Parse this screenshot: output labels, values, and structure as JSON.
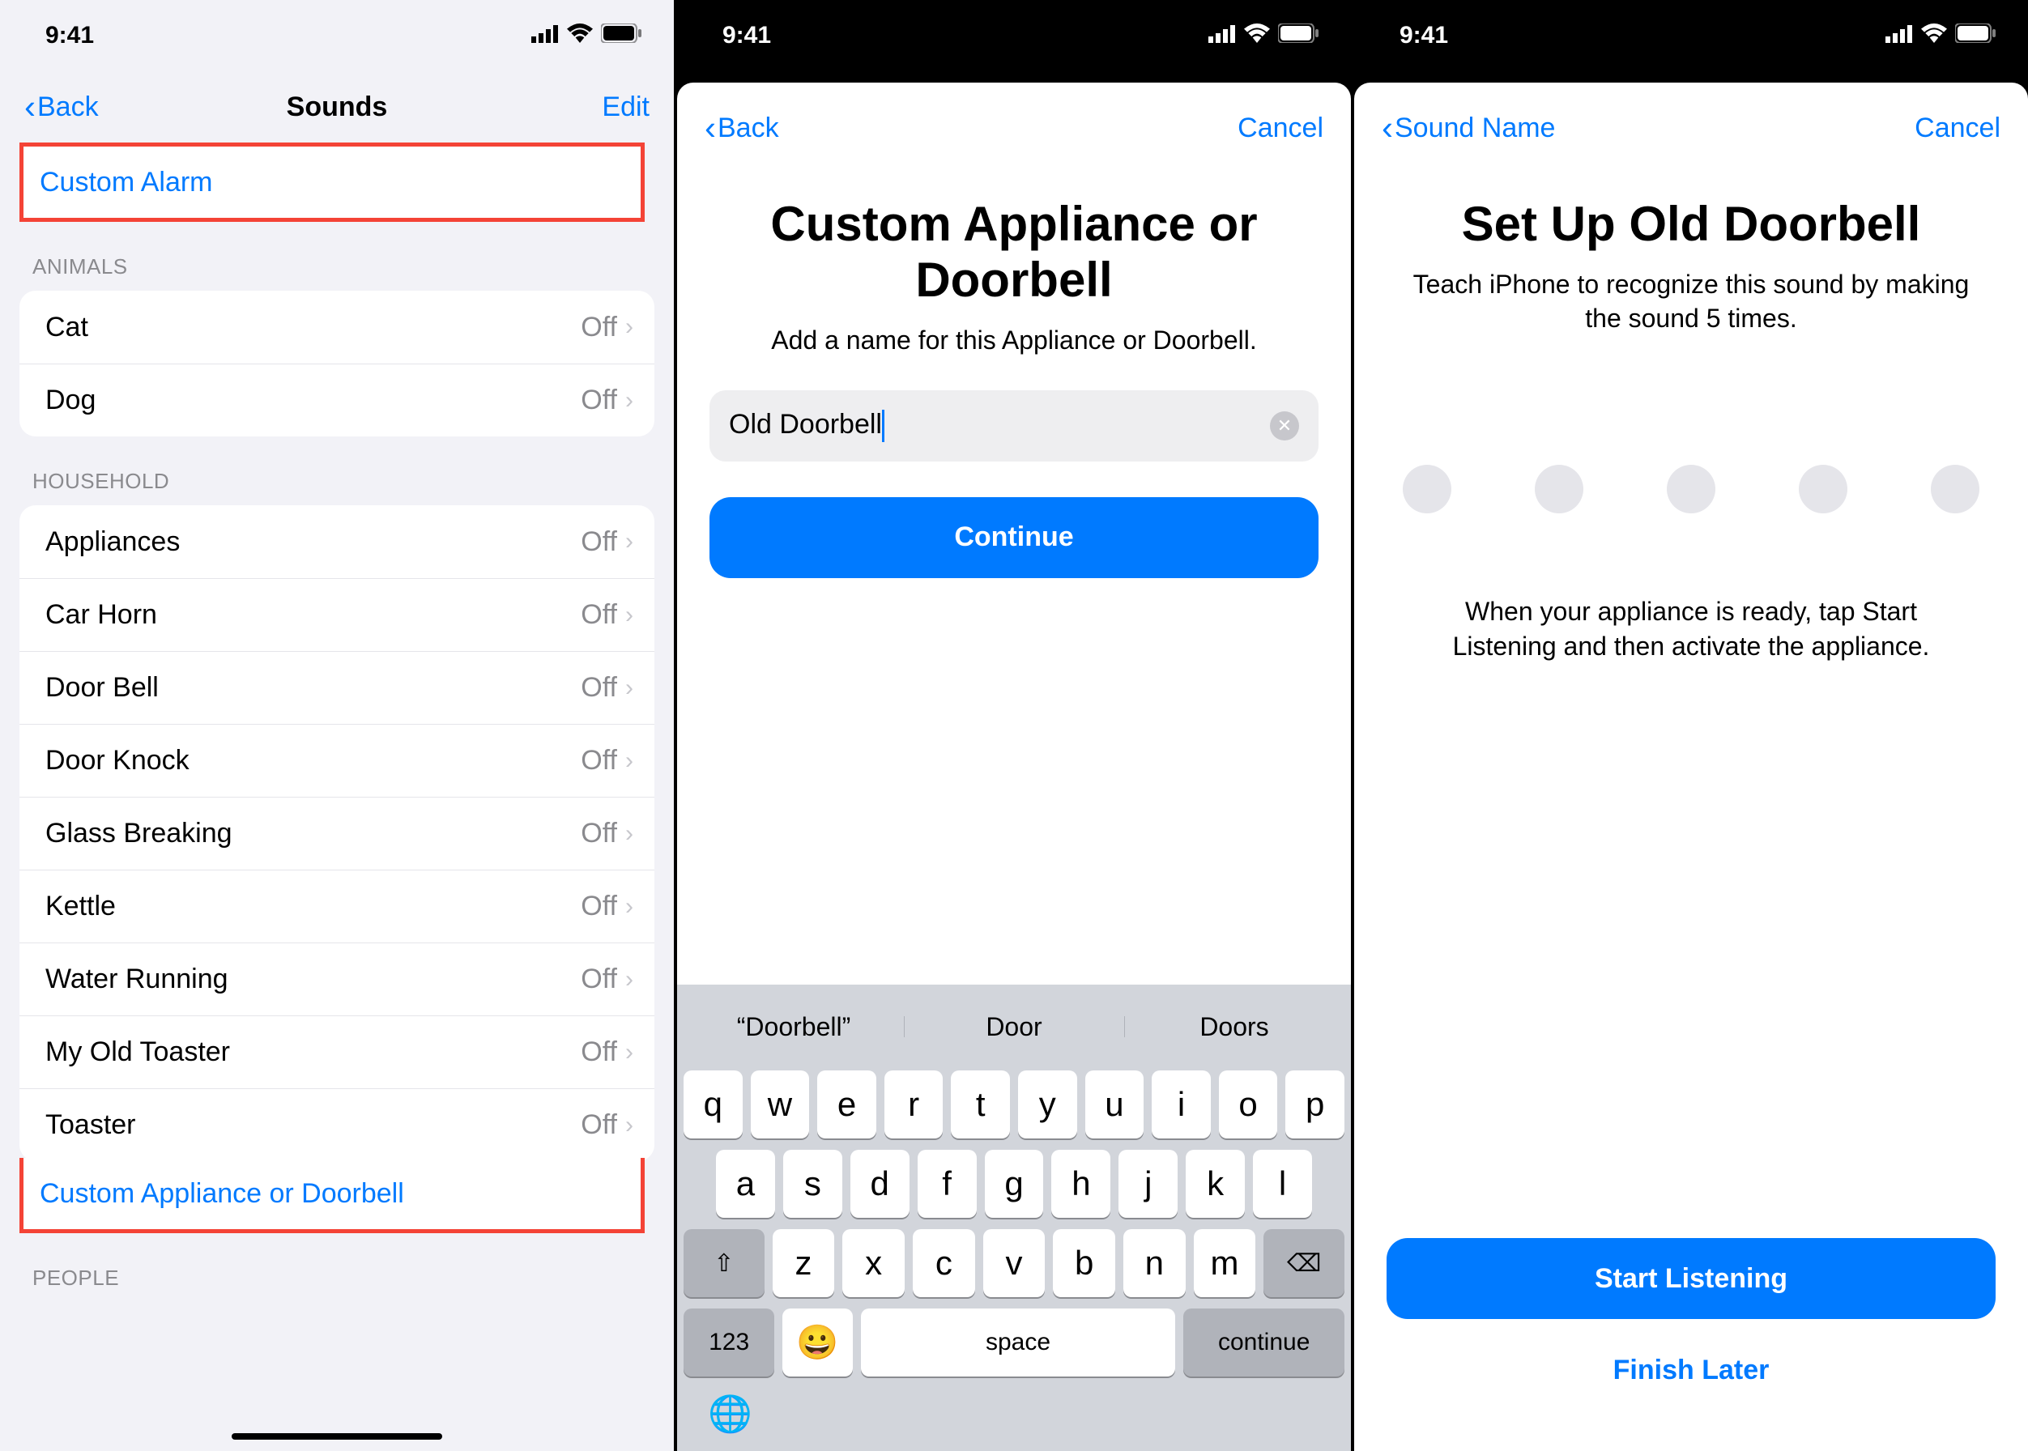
{
  "status": {
    "time": "9:41"
  },
  "screen1": {
    "nav": {
      "back": "Back",
      "title": "Sounds",
      "edit": "Edit"
    },
    "custom_alarm": "Custom Alarm",
    "sections": {
      "animals": {
        "header": "ANIMALS",
        "rows": [
          {
            "label": "Cat",
            "state": "Off"
          },
          {
            "label": "Dog",
            "state": "Off"
          }
        ]
      },
      "household": {
        "header": "HOUSEHOLD",
        "rows": [
          {
            "label": "Appliances",
            "state": "Off"
          },
          {
            "label": "Car Horn",
            "state": "Off"
          },
          {
            "label": "Door Bell",
            "state": "Off"
          },
          {
            "label": "Door Knock",
            "state": "Off"
          },
          {
            "label": "Glass Breaking",
            "state": "Off"
          },
          {
            "label": "Kettle",
            "state": "Off"
          },
          {
            "label": "Water Running",
            "state": "Off"
          },
          {
            "label": "My Old Toaster",
            "state": "Off"
          },
          {
            "label": "Toaster",
            "state": "Off"
          }
        ],
        "custom": "Custom Appliance or Doorbell"
      },
      "people": {
        "header": "PEOPLE"
      }
    }
  },
  "screen2": {
    "nav": {
      "back": "Back",
      "cancel": "Cancel"
    },
    "title": "Custom Appliance or Doorbell",
    "sub": "Add a name for this Appliance or Doorbell.",
    "input_value": "Old Doorbell",
    "button": "Continue",
    "suggestions": [
      "“Doorbell”",
      "Door",
      "Doors"
    ],
    "keys_r1": [
      "q",
      "w",
      "e",
      "r",
      "t",
      "y",
      "u",
      "i",
      "o",
      "p"
    ],
    "keys_r2": [
      "a",
      "s",
      "d",
      "f",
      "g",
      "h",
      "j",
      "k",
      "l"
    ],
    "keys_r3_mid": [
      "z",
      "x",
      "c",
      "v",
      "b",
      "n",
      "m"
    ],
    "key_num": "123",
    "key_space": "space",
    "key_continue": "continue"
  },
  "screen3": {
    "nav": {
      "back": "Sound Name",
      "cancel": "Cancel"
    },
    "title": "Set Up Old Doorbell",
    "sub": "Teach iPhone to recognize this sound by making the sound 5 times.",
    "instruction": "When your appliance is ready, tap Start Listening and then activate the appliance.",
    "start": "Start Listening",
    "finish": "Finish Later"
  }
}
